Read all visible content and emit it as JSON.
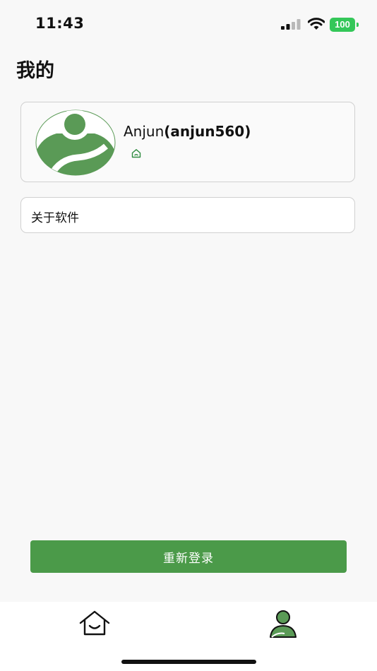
{
  "status_bar": {
    "time": "11:43",
    "battery_level": "100",
    "icons": [
      "signal-icon",
      "wifi-icon",
      "battery-icon"
    ],
    "battery_color": "#34c759"
  },
  "header": {
    "title": "我的"
  },
  "profile": {
    "display_name": "Anjun",
    "username": "(anjun560)",
    "avatar_icon": "user-avatar-icon",
    "badge_icon": "house-badge-icon"
  },
  "menu": {
    "about_label": "关于软件"
  },
  "actions": {
    "relogin_label": "重新登录"
  },
  "tab_bar": {
    "items": [
      {
        "icon": "home-icon",
        "active": false
      },
      {
        "icon": "profile-icon",
        "active": true
      }
    ]
  },
  "colors": {
    "accent": "#4b9a49",
    "background": "#f8f8f8"
  }
}
